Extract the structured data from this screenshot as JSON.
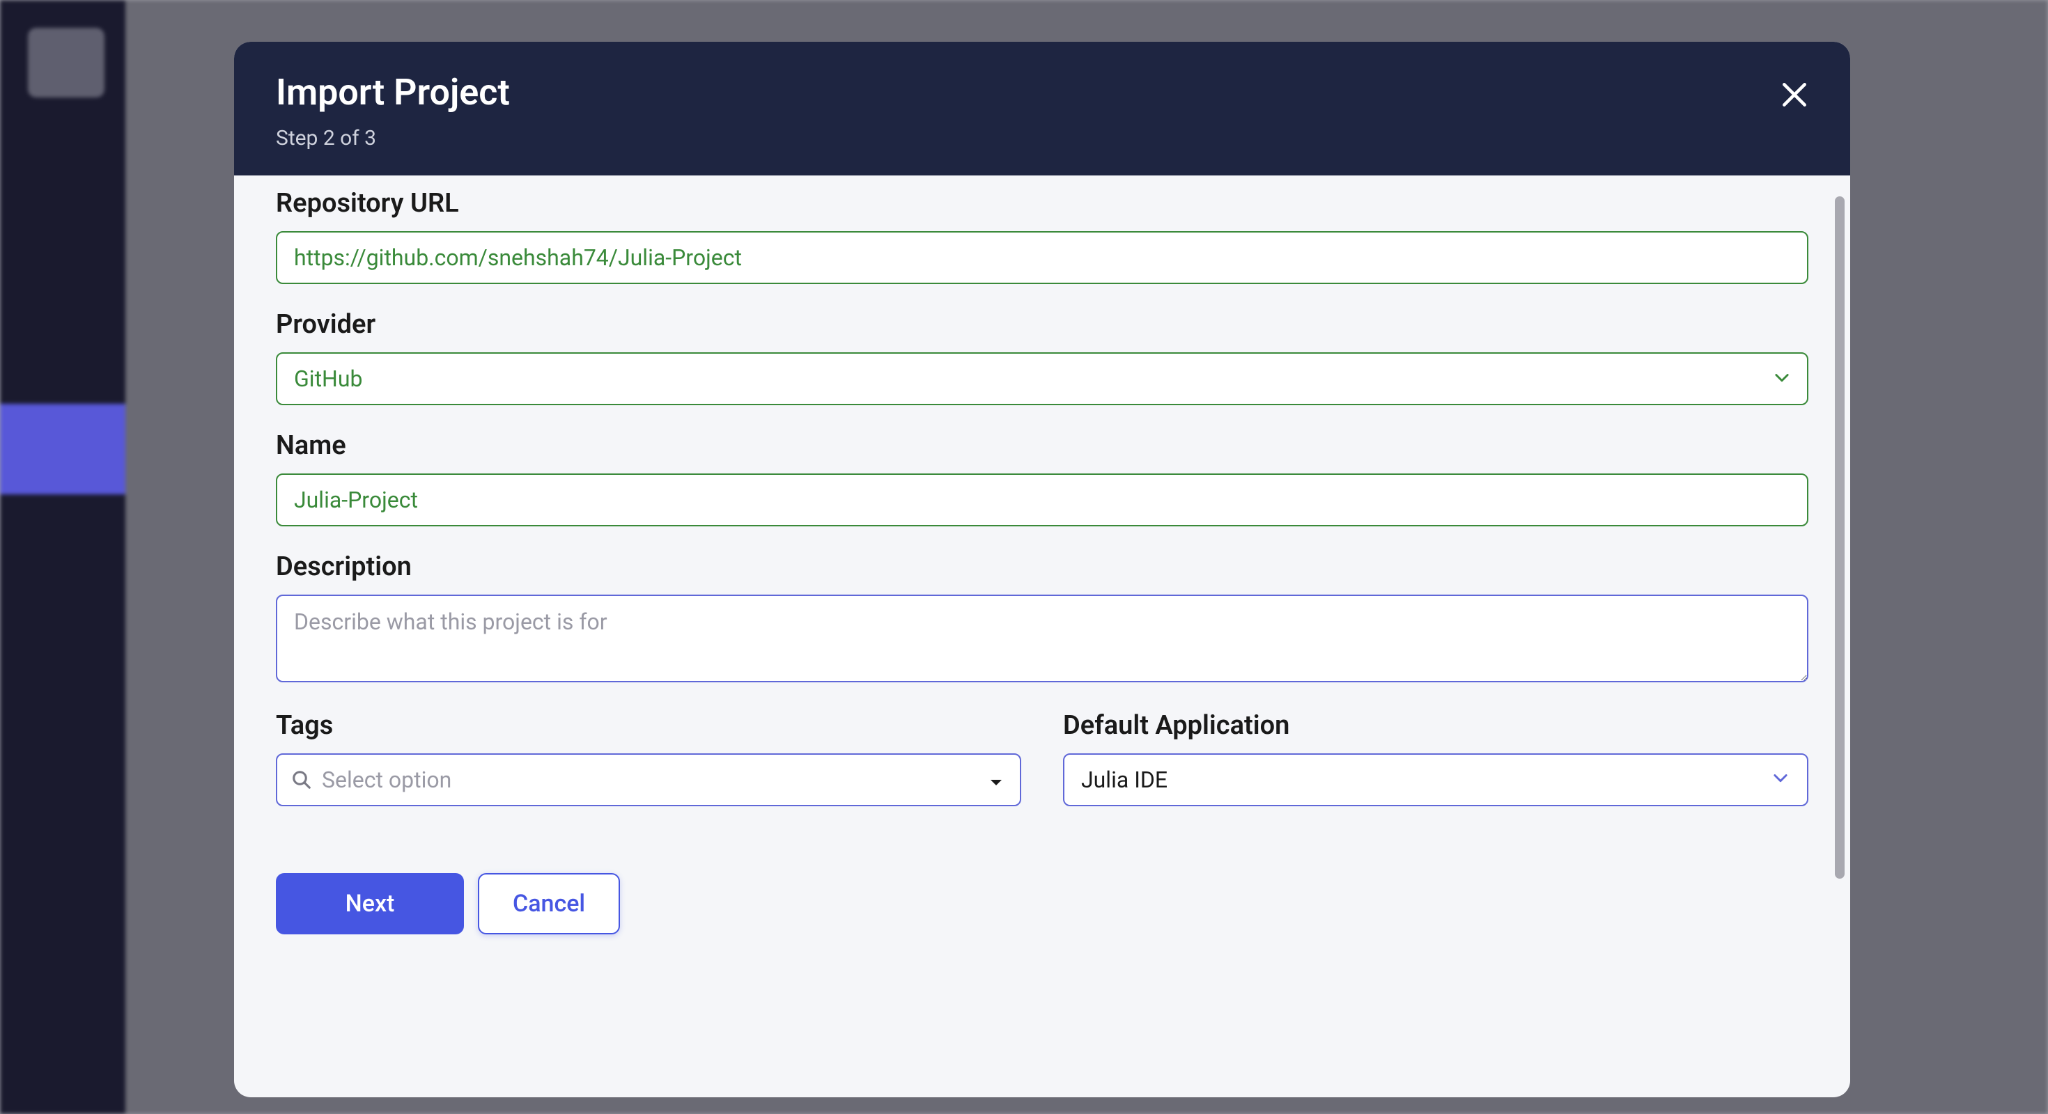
{
  "modal": {
    "title": "Import Project",
    "subtitle": "Step 2 of 3",
    "close_aria": "Close"
  },
  "fields": {
    "repo_url": {
      "label": "Repository URL",
      "value": "https://github.com/snehshah74/Julia-Project"
    },
    "provider": {
      "label": "Provider",
      "value": "GitHub"
    },
    "name": {
      "label": "Name",
      "value": "Julia-Project"
    },
    "description": {
      "label": "Description",
      "placeholder": "Describe what this project is for",
      "value": ""
    },
    "tags": {
      "label": "Tags",
      "placeholder": "Select option"
    },
    "default_app": {
      "label": "Default Application",
      "value": "Julia IDE"
    }
  },
  "actions": {
    "next": "Next",
    "cancel": "Cancel"
  }
}
